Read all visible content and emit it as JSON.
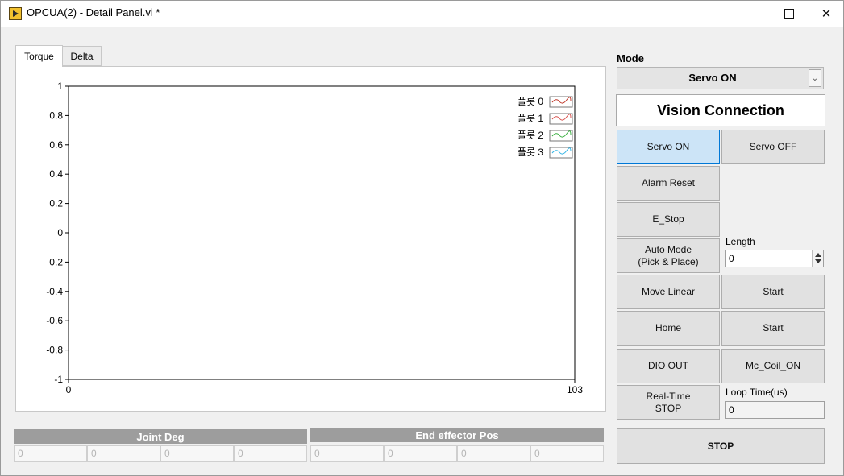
{
  "window": {
    "title": "OPCUA(2) - Detail Panel.vi *",
    "min_glyph": "",
    "max_glyph": "",
    "close_glyph": "✕"
  },
  "tabs": [
    {
      "label": "Torque",
      "selected": true
    },
    {
      "label": "Delta",
      "selected": false
    }
  ],
  "chart_data": {
    "type": "line",
    "x": [],
    "xlim": [
      0,
      103
    ],
    "ylim": [
      -1,
      1
    ],
    "y_ticks": [
      "1",
      "0.8",
      "0.6",
      "0.4",
      "0.2",
      "0",
      "-0.2",
      "-0.4",
      "-0.6",
      "-0.8",
      "-1"
    ],
    "x_ticks": [
      "0",
      "103"
    ],
    "series": [
      {
        "name": "플롯 0",
        "color": "#c0392b",
        "values": []
      },
      {
        "name": "플롯 1",
        "color": "#d9534f",
        "values": []
      },
      {
        "name": "플롯 2",
        "color": "#3cb043",
        "values": []
      },
      {
        "name": "플롯 3",
        "color": "#35b5e5",
        "values": []
      }
    ],
    "legend_position": "top-right",
    "grid": false
  },
  "joint_deg": {
    "title": "Joint Deg",
    "values": [
      "0",
      "0",
      "0",
      "0"
    ]
  },
  "end_effector": {
    "title": "End effector Pos",
    "values": [
      "0",
      "0",
      "0",
      "0"
    ]
  },
  "mode": {
    "label": "Mode",
    "value": "Servo ON"
  },
  "vision_connection": "Vision Connection",
  "buttons": {
    "servo_on": "Servo ON",
    "servo_off": "Servo OFF",
    "alarm_reset": "Alarm Reset",
    "e_stop": "E_Stop",
    "auto_mode": "Auto Mode\n(Pick & Place)",
    "move_linear": "Move Linear",
    "start_1": "Start",
    "home": "Home",
    "start_2": "Start",
    "dio_out": "DIO OUT",
    "mc_coil_on": "Mc_Coil_ON",
    "realtime_stop": "Real-Time\nSTOP",
    "stop": "STOP"
  },
  "length": {
    "label": "Length",
    "value": "0"
  },
  "loop_time": {
    "label": "Loop Time(us)",
    "value": "0"
  },
  "colors": {
    "active_button": "#cce4f7",
    "active_border": "#0078d7",
    "cluster_header": "#9d9d9d"
  }
}
